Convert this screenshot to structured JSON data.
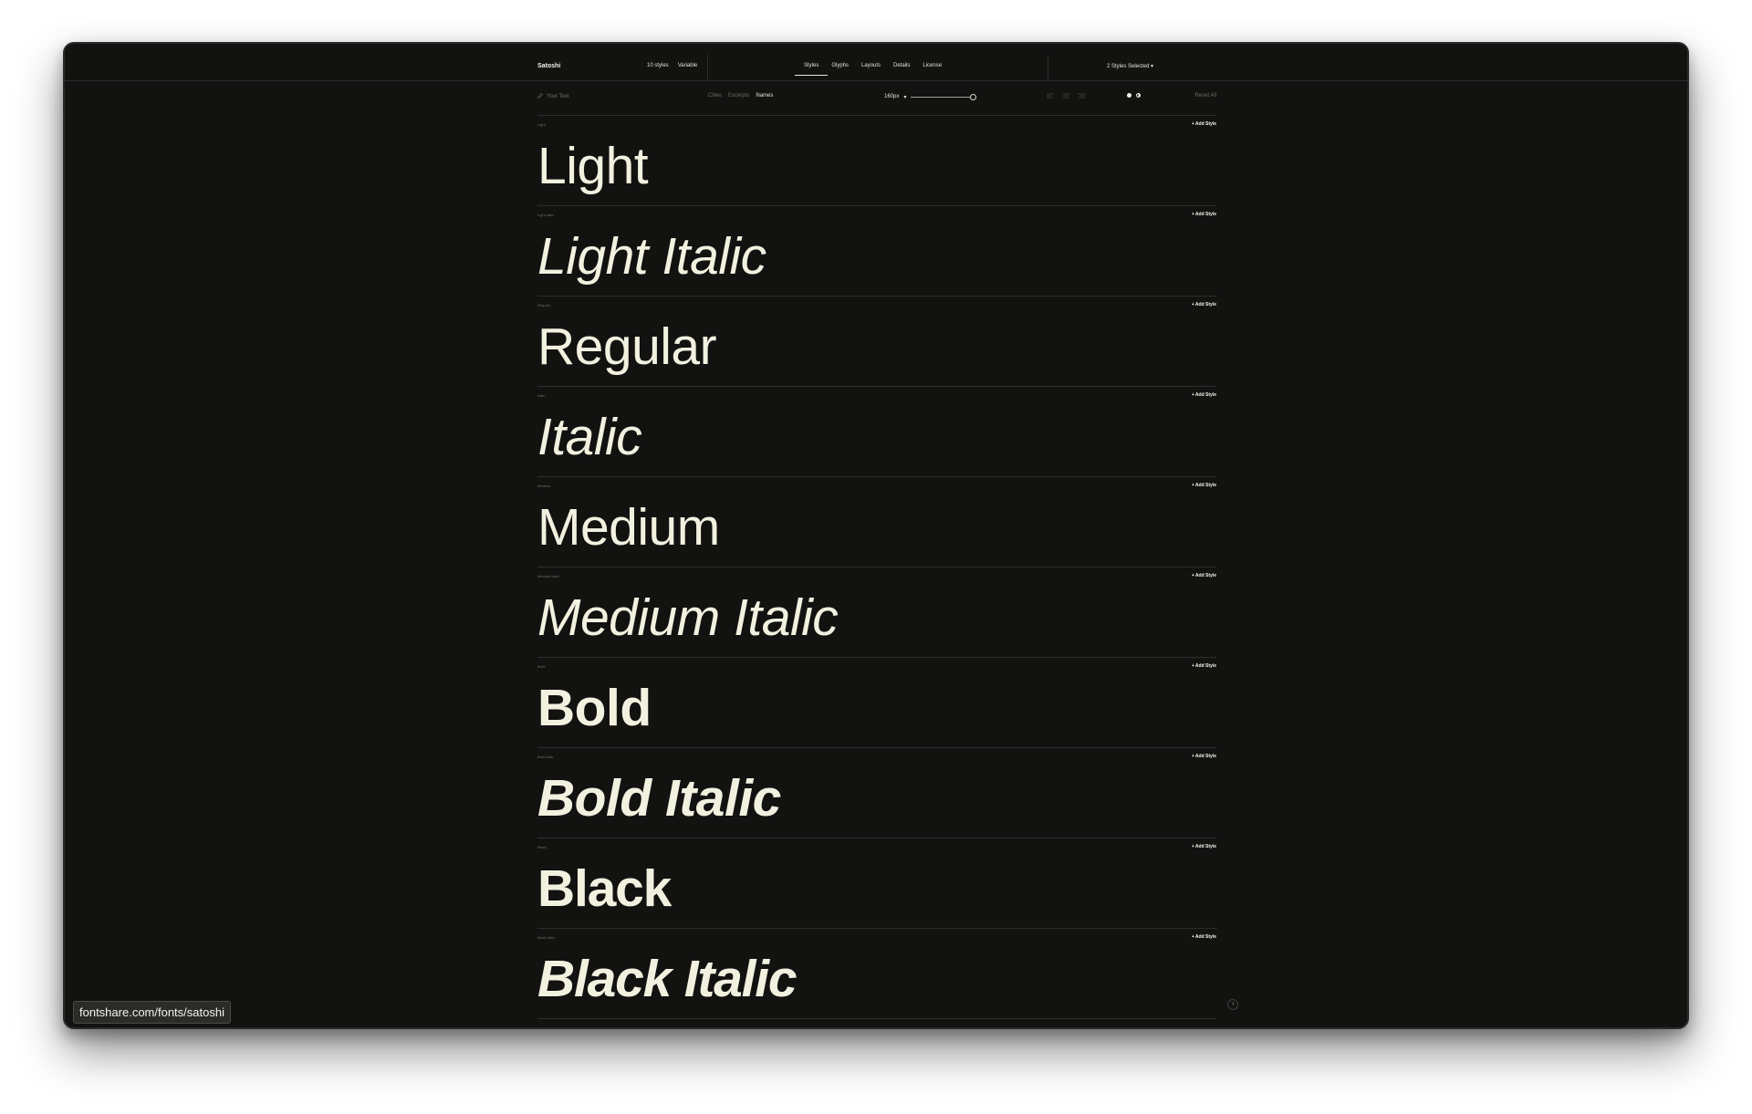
{
  "header": {
    "brand": "Satoshi",
    "styles_count": "10 styles",
    "variable_link": "Variable",
    "tabs": [
      {
        "label": "Styles"
      },
      {
        "label": "Glyphs"
      },
      {
        "label": "Layouts"
      },
      {
        "label": "Details"
      },
      {
        "label": "License"
      }
    ],
    "styles_selected": "2 Styles Selected",
    "caret": "▾"
  },
  "toolbar": {
    "type_text_placeholder": "Your Text",
    "segments": [
      "Cities",
      "Excerpts",
      "Names"
    ],
    "active_segment": "Names",
    "size_value": "160px",
    "size_caret": "▾",
    "size_slider_fraction": 1.0,
    "align_options": [
      "left",
      "center",
      "right"
    ],
    "reset_label": "Reset All"
  },
  "styles": [
    {
      "label": "Light",
      "sample": "Light",
      "add_label": "+ Add Style"
    },
    {
      "label": "Light Italic",
      "sample": "Light Italic",
      "add_label": "+ Add Style"
    },
    {
      "label": "Regular",
      "sample": "Regular",
      "add_label": "+ Add Style"
    },
    {
      "label": "Italic",
      "sample": "Italic",
      "add_label": "+ Add Style"
    },
    {
      "label": "Medium",
      "sample": "Medium",
      "add_label": "+ Add Style"
    },
    {
      "label": "Medium Italic",
      "sample": "Medium Italic",
      "add_label": "+ Add Style"
    },
    {
      "label": "Bold",
      "sample": "Bold",
      "add_label": "+ Add Style"
    },
    {
      "label": "Bold Italic",
      "sample": "Bold Italic",
      "add_label": "+ Add Style"
    },
    {
      "label": "Black",
      "sample": "Black",
      "add_label": "+ Add Style"
    },
    {
      "label": "Black Italic",
      "sample": "Black Italic",
      "add_label": "+ Add Style"
    }
  ],
  "status_url": "fontshare.com/fonts/satoshi",
  "scroll_top_icon": "↑",
  "colors": {
    "background": "#121211",
    "text": "#f2f1e0",
    "divider": "#2d2d2b"
  }
}
